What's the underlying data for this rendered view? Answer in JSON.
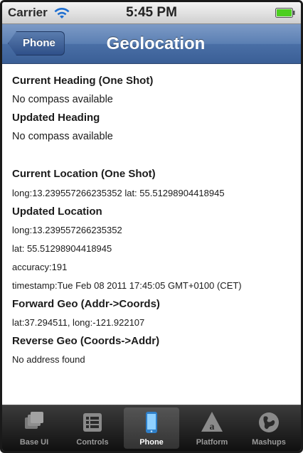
{
  "status_bar": {
    "carrier": "Carrier",
    "time": "5:45 PM"
  },
  "nav_bar": {
    "back_label": "Phone",
    "title": "Geolocation"
  },
  "sections": {
    "current_heading_title": "Current Heading (One Shot)",
    "current_heading_value": "No compass available",
    "updated_heading_title": "Updated Heading",
    "updated_heading_value": "No compass available",
    "current_location_title": "Current Location (One Shot)",
    "current_location_value": "long:13.239557266235352 lat: 55.51298904418945",
    "updated_location_title": "Updated Location",
    "updated_location_long": "long:13.239557266235352",
    "updated_location_lat": "lat: 55.51298904418945",
    "updated_location_accuracy": "accuracy:191",
    "updated_location_timestamp": "timestamp:Tue Feb 08 2011 17:45:05 GMT+0100 (CET)",
    "forward_geo_title": "Forward Geo (Addr->Coords)",
    "forward_geo_value": "lat:37.294511, long:-121.922107",
    "reverse_geo_title": "Reverse Geo (Coords->Addr)",
    "reverse_geo_value": "No address found"
  },
  "tab_bar": {
    "tabs": [
      {
        "label": "Base UI",
        "icon": "base-ui-icon",
        "selected": false
      },
      {
        "label": "Controls",
        "icon": "controls-icon",
        "selected": false
      },
      {
        "label": "Phone",
        "icon": "phone-icon",
        "selected": true
      },
      {
        "label": "Platform",
        "icon": "platform-icon",
        "selected": false
      },
      {
        "label": "Mashups",
        "icon": "mashups-icon",
        "selected": false
      }
    ]
  },
  "colors": {
    "nav_bar": "#4a6fa6",
    "tab_bar": "#1c1c1c",
    "battery": "#4ccf1f",
    "selected_tab_icon": "#5aaee8"
  }
}
